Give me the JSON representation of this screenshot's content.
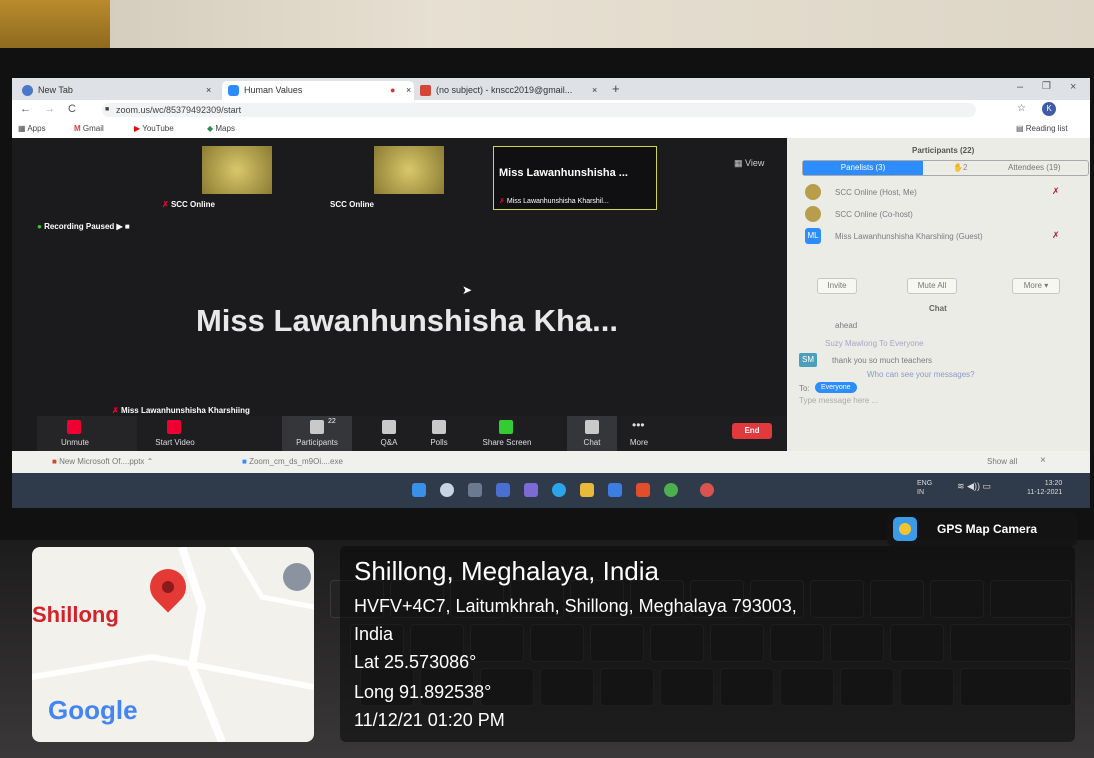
{
  "browser": {
    "tabs": [
      {
        "label": "New Tab",
        "icon": "chrome-icon"
      },
      {
        "label": "Human Values",
        "icon": "zoom-icon"
      },
      {
        "label": "(no subject) - knscc2019@gmail...",
        "icon": "gmail-icon"
      }
    ],
    "url": "zoom.us/wc/85379492309/start",
    "bookmarks": [
      "Apps",
      "Gmail",
      "YouTube",
      "Maps"
    ],
    "reading_list": "Reading list"
  },
  "zoom": {
    "view_label": "View",
    "participants_tiles": [
      {
        "name": "SCC Online"
      },
      {
        "name": "SCC Online"
      },
      {
        "name": "Miss Lawanhunshisha ...",
        "subname": "Miss Lawanhunshisha Kharshil..."
      }
    ],
    "recording_status": "Recording Paused",
    "active_speaker": "Miss Lawanhunshisha Kha...",
    "speaker_label": "Miss Lawanhunshisha Kharshiing",
    "toolbar": {
      "unmute": "Unmute",
      "start_video": "Start Video",
      "participants": "Participants",
      "participants_count": "22",
      "qa": "Q&A",
      "polls": "Polls",
      "share_screen": "Share Screen",
      "chat": "Chat",
      "more": "More",
      "end": "End"
    }
  },
  "panel": {
    "title": "Participants (22)",
    "tabs": {
      "panelists": "Panelists (3)",
      "raised": "2",
      "attendees": "Attendees (19)"
    },
    "list": [
      {
        "name": "SCC Online (Host, Me)"
      },
      {
        "name": "SCC Online (Co-host)"
      },
      {
        "initials": "ML",
        "name": "Miss Lawanhunshisha Kharshiing (Guest)"
      }
    ],
    "buttons": {
      "invite": "Invite",
      "mute_all": "Mute All",
      "more": "More"
    },
    "chat_title": "Chat",
    "chat": {
      "prev": "ahead",
      "sender": "Suzy Mawlong  To  Everyone",
      "initials": "SM",
      "message": "thank you so much teachers",
      "notice": "Who can see your messages?",
      "to_label": "To:",
      "to_value": "Everyone",
      "placeholder": "Type message here ..."
    }
  },
  "downloads": {
    "items": [
      "New Microsoft Of....pptx",
      "Zoom_cm_ds_m9Oi....exe"
    ],
    "show_all": "Show all"
  },
  "taskbar": {
    "lang": "ENG",
    "region": "IN",
    "time": "13:20",
    "date": "11-12-2021"
  },
  "gps": {
    "badge": "GPS Map Camera",
    "map_city": "Shillong",
    "map_brand": "Google",
    "place": "Shillong, Meghalaya, India",
    "address_line1": "HVFV+4C7, Laitumkhrah, Shillong, Meghalaya 793003,",
    "address_line2": "India",
    "lat": "Lat 25.573086°",
    "long": "Long 91.892538°",
    "datetime": "11/12/21 01:20 PM"
  }
}
